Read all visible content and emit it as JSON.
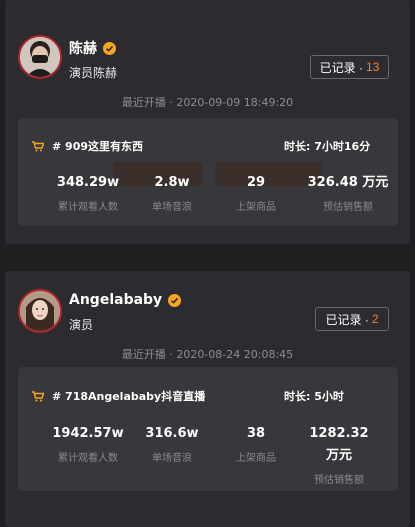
{
  "cards": [
    {
      "name": "陈赫",
      "subtitle": "演员陈赫",
      "record_label": "已记录 ·",
      "record_count": "13",
      "recent_stream": "最近开播 · 2020-09-09 18:49:20",
      "stream_title": "# 909这里有东西",
      "duration": "时长: 7小时16分",
      "stats": [
        {
          "value": "348.29w",
          "label": "累计观看人数"
        },
        {
          "value": "2.8w",
          "label": "单场音浪"
        },
        {
          "value": "29",
          "label": "上架商品"
        },
        {
          "value": "326.48 万元",
          "label": "预估销售额"
        }
      ]
    },
    {
      "name": "Angelababy",
      "subtitle": "演员",
      "record_label": "已记录 ·",
      "record_count": "2",
      "recent_stream": "最近开播 · 2020-08-24 20:08:45",
      "stream_title": "# 718Angelababy抖音直播",
      "duration": "时长: 5小时",
      "stats": [
        {
          "value": "1942.57w",
          "label": "累计观看人数"
        },
        {
          "value": "316.6w",
          "label": "单场音浪"
        },
        {
          "value": "38",
          "label": "上架商品"
        },
        {
          "value": "1282.32 万元",
          "label": "预估销售额"
        }
      ]
    }
  ],
  "icons": {
    "verified": "verified-badge-icon",
    "cart": "shopping-cart-icon"
  },
  "colors": {
    "accent": "#ff7b2c",
    "verified": "#f5a623",
    "avatar_border": "#b3262d"
  }
}
